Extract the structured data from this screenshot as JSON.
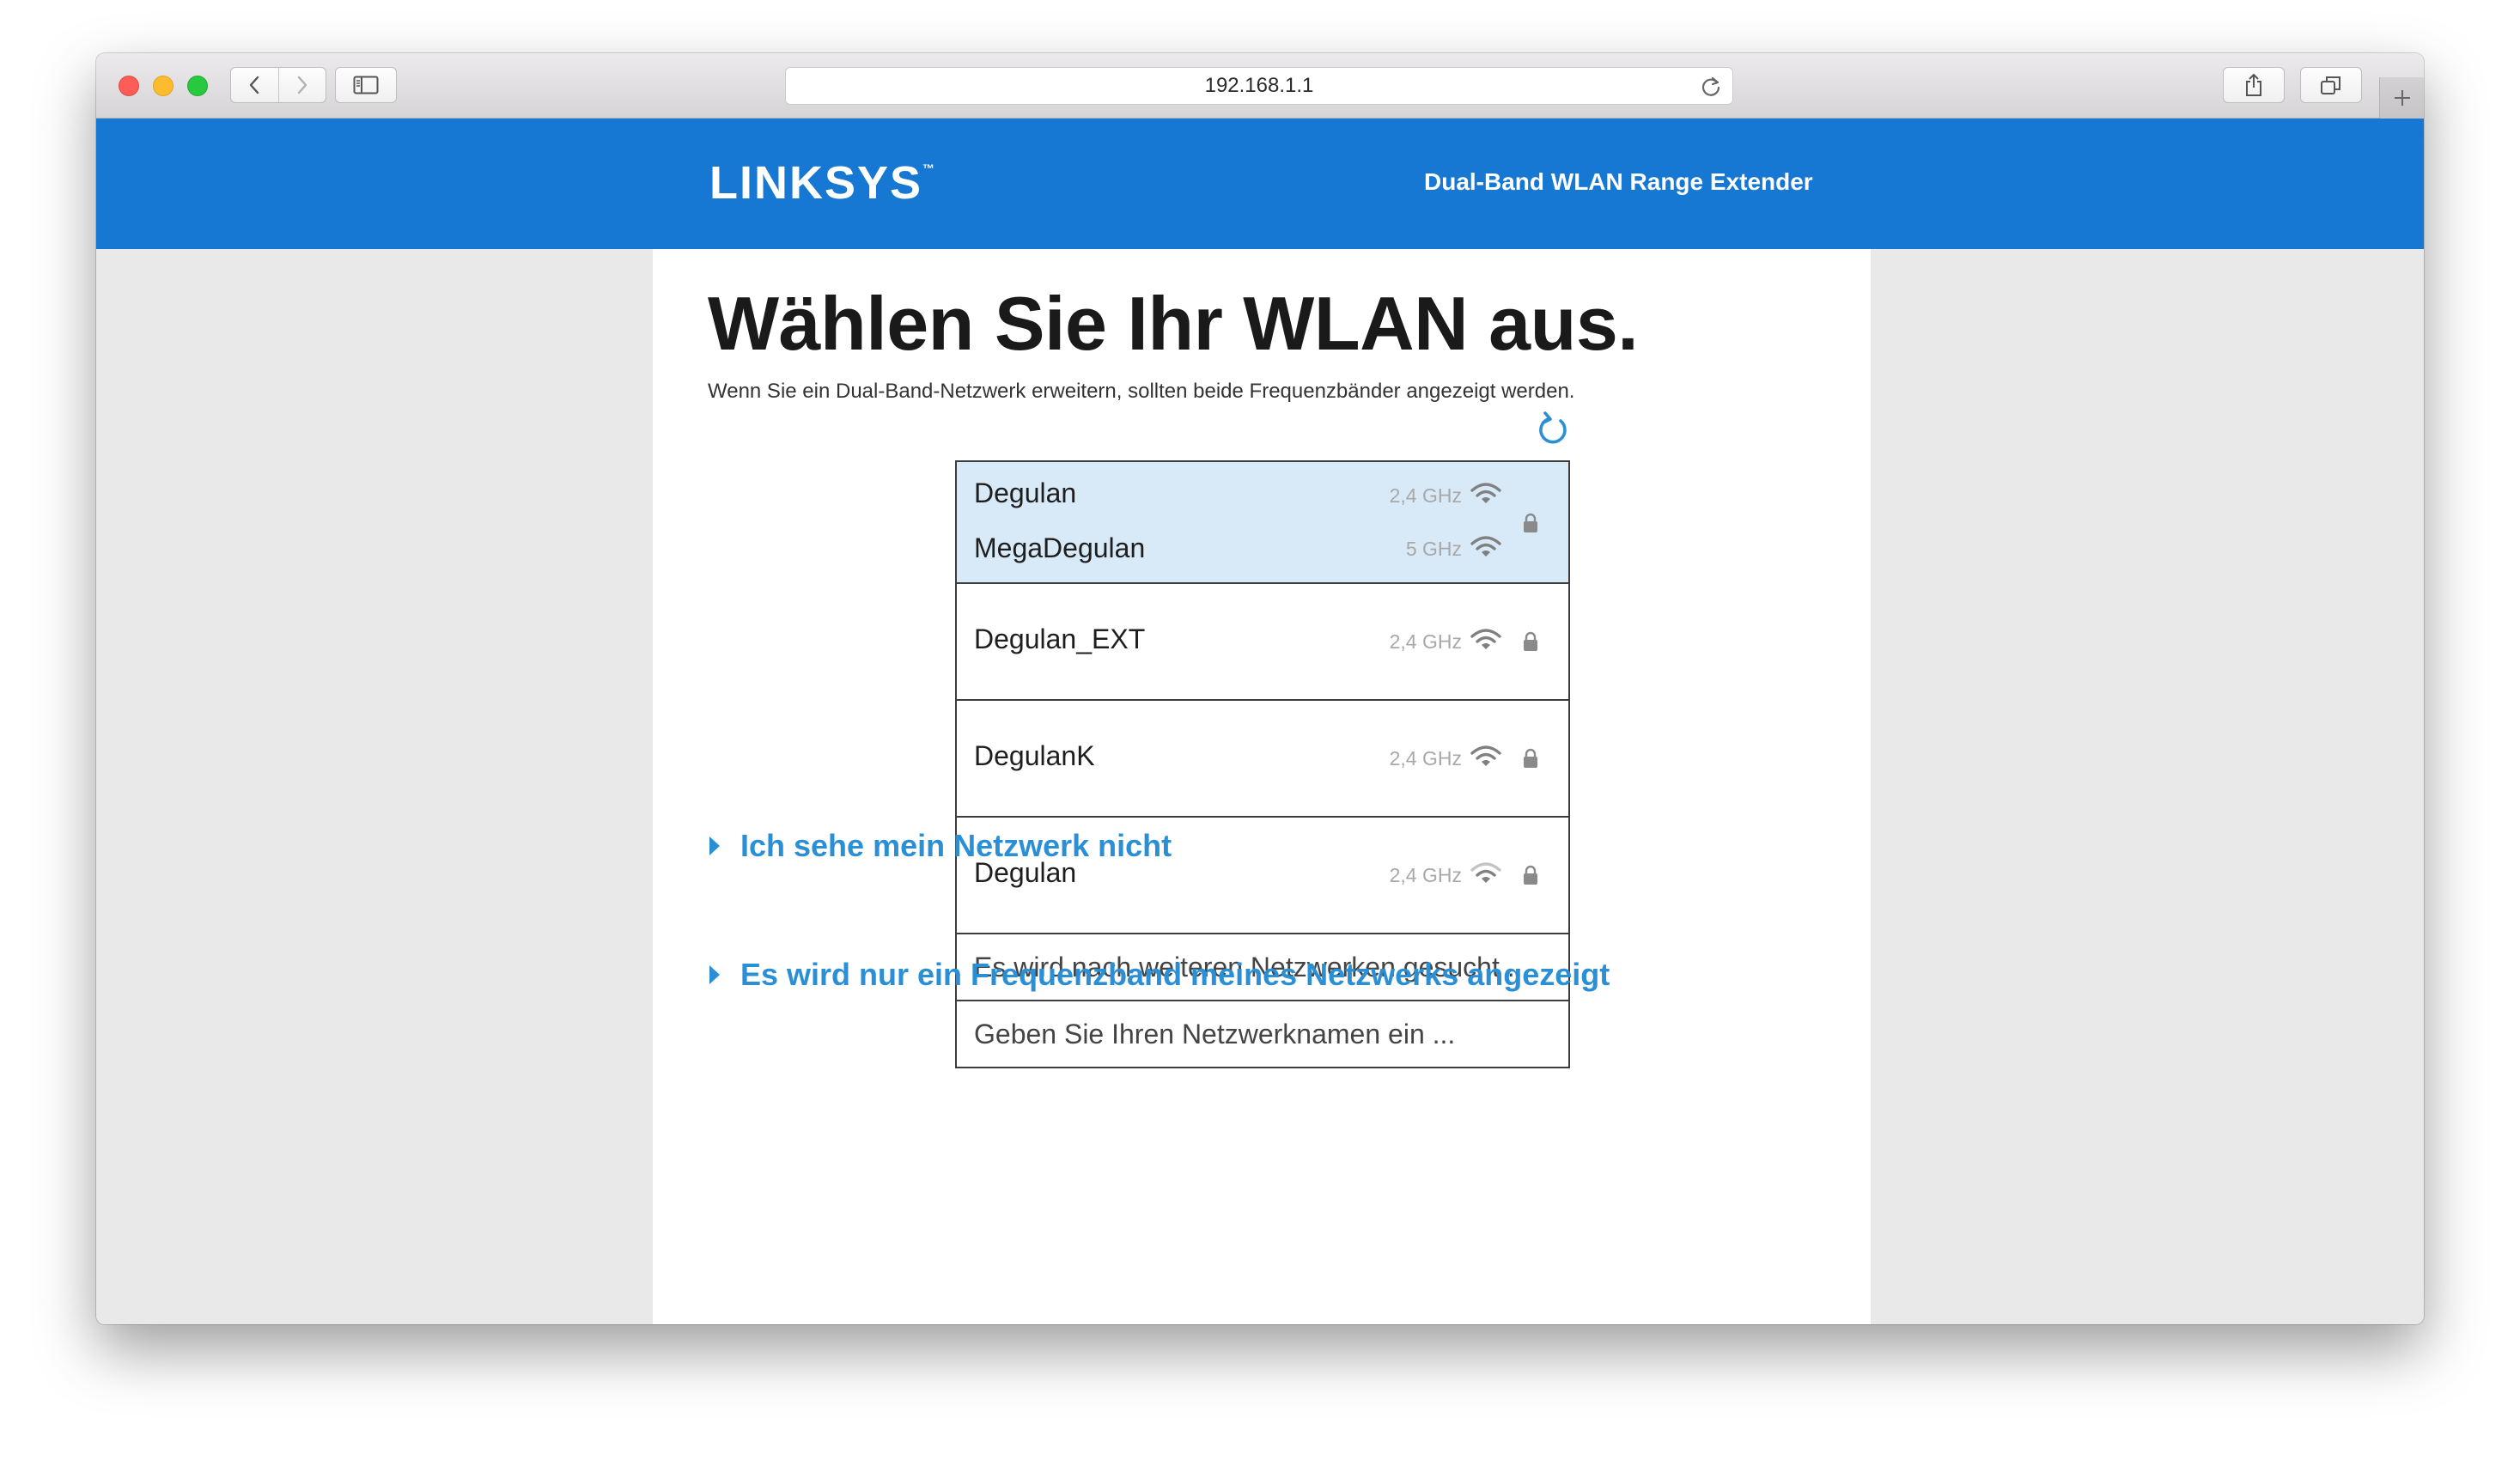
{
  "browser": {
    "url": "192.168.1.1"
  },
  "header": {
    "logo_text": "LINKSYS",
    "logo_tm": "™",
    "product_name": "Dual-Band WLAN Range Extender",
    "brand_color": "#1778d4"
  },
  "main": {
    "title": "Wählen Sie Ihr WLAN aus.",
    "subtitle": "Wenn Sie ein Dual-Band-Netzwerk erweitern, sollten beide Frequenzbänder angezeigt werden."
  },
  "networks": [
    {
      "ssid": "Degulan",
      "band": "2,4 GHz",
      "selected": true
    },
    {
      "ssid": "MegaDegulan",
      "band": "5 GHz",
      "selected": true
    },
    {
      "ssid": "Degulan_EXT",
      "band": "2,4 GHz",
      "selected": false
    },
    {
      "ssid": "DegulanK",
      "band": "2,4 GHz",
      "selected": false
    },
    {
      "ssid": "Degulan",
      "band": "2,4 GHz",
      "selected": false
    }
  ],
  "list_actions": {
    "searching": "Es wird nach weiteren Netzwerken gesucht ...",
    "manual_entry": "Geben Sie Ihren Netzwerknamen ein ..."
  },
  "help_links": [
    "Ich sehe mein Netzwerk nicht",
    "Es wird nur ein Frequenzband meines Netzwerks angezeigt"
  ],
  "colors": {
    "selected_row": "#d8eaf8",
    "link": "#2b8fd6",
    "frequency_text": "#a8a8a8"
  },
  "icons": {
    "wifi": "wifi-icon",
    "lock": "lock-icon",
    "refresh": "refresh-icon"
  }
}
